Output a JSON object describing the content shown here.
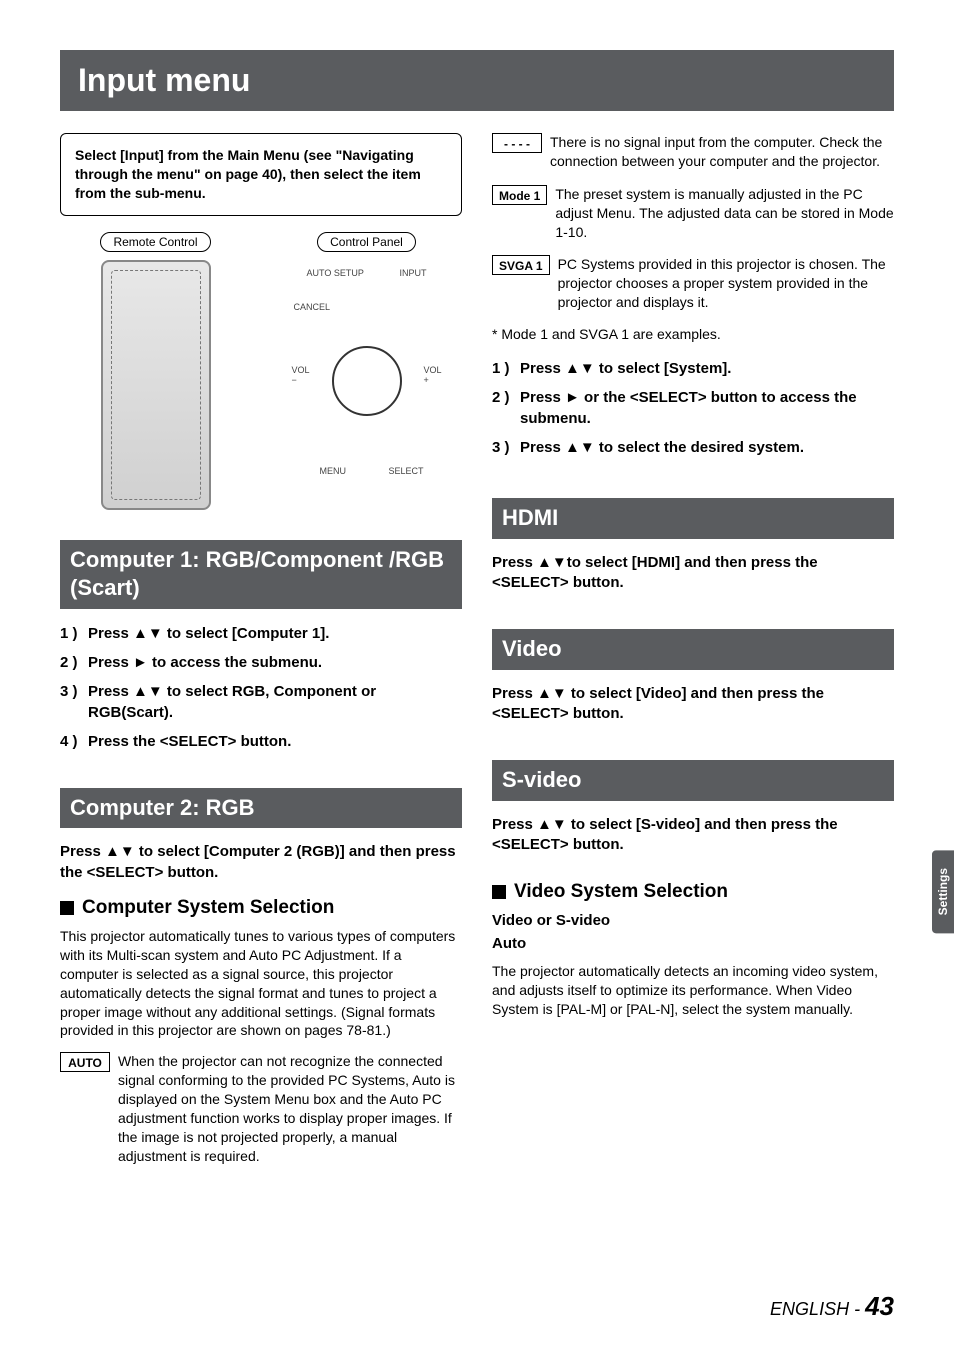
{
  "page_title": "Input menu",
  "intro_box": "Select [Input] from the Main Menu (see \"Navigating through the menu\" on page 40), then select the item from the sub-menu.",
  "diagram": {
    "remote_label": "Remote Control",
    "panel_label": "Control Panel",
    "panel_text": {
      "auto_setup": "AUTO SETUP",
      "input": "INPUT",
      "cancel": "CANCEL",
      "vol_minus": "VOL\n−",
      "vol_plus": "VOL\n+",
      "menu": "MENU",
      "select": "SELECT"
    }
  },
  "left": {
    "sec1_title": "Computer 1: RGB/Component /RGB (Scart)",
    "sec1_steps": [
      "Press ▲▼ to select [Computer 1].",
      "Press ► to access the submenu.",
      "Press ▲▼ to select RGB, Component or RGB(Scart).",
      "Press the <SELECT> button."
    ],
    "sec2_title": "Computer 2: RGB",
    "sec2_inst": "Press ▲▼ to select [Computer 2 (RGB)] and then press the <SELECT> button.",
    "subhead1": "Computer System Selection",
    "subhead1_body": "This projector automatically tunes to various types of computers with its Multi-scan system and Auto PC Adjustment. If a computer is selected as a signal source, this projector automatically detects the signal format and tunes to project a proper image without any additional settings. (Signal formats provided in this projector are shown on pages 78-81.)",
    "auto_badge": "AUTO",
    "auto_desc": "When the projector can not recognize the connected signal conforming to the provided PC Systems, Auto is displayed on the System Menu box and the Auto PC adjustment function works to display proper images.  If the image is not projected properly, a manual adjustment is required."
  },
  "right": {
    "dashes_badge": "- - - -",
    "dashes_desc": "There is no signal input from the computer. Check the connection between your computer and the projector.",
    "mode1_badge": "Mode 1",
    "mode1_desc": "The preset system is manually adjusted in the PC adjust Menu. The adjusted data can be stored in Mode 1-10.",
    "svga1_badge": "SVGA 1",
    "svga1_desc": "PC Systems provided in this projector is chosen. The projector chooses a proper system provided in the projector and displays it.",
    "mode_footnote": "* Mode 1 and SVGA 1 are examples.",
    "steps": [
      "Press ▲▼ to select [System].",
      "Press ► or the <SELECT> button to access the submenu.",
      "Press ▲▼ to select the desired system."
    ],
    "hdmi_title": "HDMI",
    "hdmi_inst": "Press ▲▼to select [HDMI] and then press the <SELECT> button.",
    "video_title": "Video",
    "video_inst": "Press ▲▼ to select [Video] and then press the <SELECT> button.",
    "svideo_title": "S-video",
    "svideo_inst": "Press ▲▼ to select [S-video] and then press the <SELECT> button.",
    "subhead2": "Video System Selection",
    "vs_heading1": "Video or S-video",
    "vs_heading2": "Auto",
    "vs_body": "The projector automatically detects an incoming video system, and adjusts itself to optimize its performance. When Video System is [PAL-M] or [PAL-N], select the system manually."
  },
  "side_tab": "Settings",
  "footer_lang": "ENGLISH - ",
  "footer_page": "43"
}
